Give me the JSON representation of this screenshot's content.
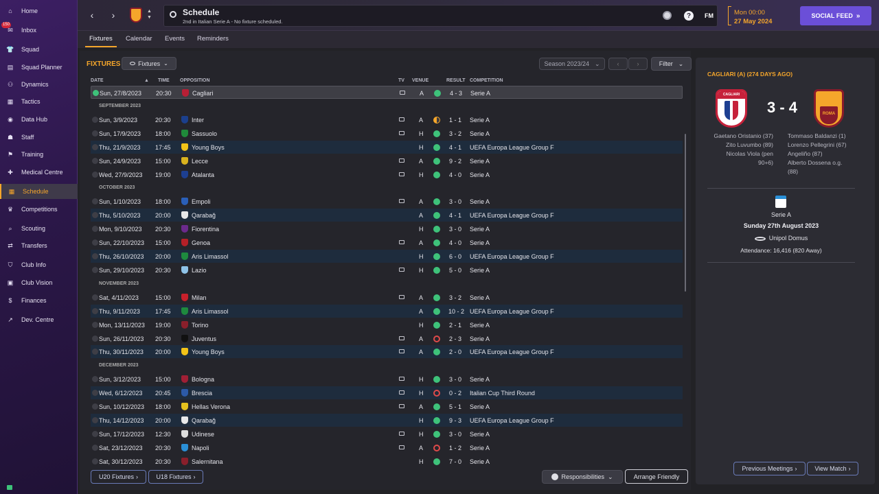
{
  "sidebar": {
    "inbox_badge": "150",
    "items": [
      {
        "label": "Home",
        "icon": "home-icon"
      },
      {
        "label": "Inbox",
        "icon": "inbox-icon"
      },
      {
        "label": "Squad",
        "icon": "squad-icon"
      },
      {
        "label": "Squad Planner",
        "icon": "clipboard-icon"
      },
      {
        "label": "Dynamics",
        "icon": "dynamics-icon"
      },
      {
        "label": "Tactics",
        "icon": "tactics-icon"
      },
      {
        "label": "Data Hub",
        "icon": "data-hub-icon"
      },
      {
        "label": "Staff",
        "icon": "staff-icon"
      },
      {
        "label": "Training",
        "icon": "training-icon"
      },
      {
        "label": "Medical Centre",
        "icon": "medical-icon"
      },
      {
        "label": "Schedule",
        "icon": "calendar-icon"
      },
      {
        "label": "Competitions",
        "icon": "trophy-icon"
      },
      {
        "label": "Scouting",
        "icon": "scouting-icon"
      },
      {
        "label": "Transfers",
        "icon": "transfers-icon"
      },
      {
        "label": "Club Info",
        "icon": "shield-icon"
      },
      {
        "label": "Club Vision",
        "icon": "club-vision-icon"
      },
      {
        "label": "Finances",
        "icon": "finances-icon"
      },
      {
        "label": "Dev. Centre",
        "icon": "dev-centre-icon"
      }
    ]
  },
  "header": {
    "title": "Schedule",
    "subtitle": "2nd in Italian Serie A - No fixture scheduled.",
    "fm_label": "FM",
    "date_time": "Mon 00:00",
    "date": "27 May 2024",
    "social_feed": "SOCIAL FEED"
  },
  "tabs": [
    "Fixtures",
    "Calendar",
    "Events",
    "Reminders"
  ],
  "toolbar": {
    "section_title": "FIXTURES",
    "view_dropdown": "Fixtures",
    "season": "Season 2023/24",
    "filter": "Filter"
  },
  "columns": {
    "date": "DATE",
    "time": "TIME",
    "opposition": "OPPOSITION",
    "tv": "TV",
    "venue": "VENUE",
    "result": "RESULT",
    "competition": "COMPETITION"
  },
  "rows": [
    {
      "kind": "match",
      "date": "Sun, 27/8/2023",
      "time": "20:30",
      "opp": "Cagliari",
      "tv": true,
      "venue": "A",
      "res": "win",
      "score": "4 - 3",
      "comp": "Serie A",
      "hl": false,
      "first": true,
      "crest": "#b81f35"
    },
    {
      "kind": "month",
      "label": "SEPTEMBER 2023"
    },
    {
      "kind": "match",
      "date": "Sun, 3/9/2023",
      "time": "20:30",
      "opp": "Inter",
      "tv": true,
      "venue": "A",
      "res": "draw",
      "score": "1 - 1",
      "comp": "Serie A",
      "hl": false,
      "crest": "#1b3f8c"
    },
    {
      "kind": "match",
      "date": "Sun, 17/9/2023",
      "time": "18:00",
      "opp": "Sassuolo",
      "tv": true,
      "venue": "H",
      "res": "win",
      "score": "3 - 2",
      "comp": "Serie A",
      "hl": false,
      "crest": "#1f8a3a"
    },
    {
      "kind": "match",
      "date": "Thu, 21/9/2023",
      "time": "17:45",
      "opp": "Young Boys",
      "tv": false,
      "venue": "H",
      "res": "win",
      "score": "4 - 1",
      "comp": "UEFA Europa League Group F",
      "hl": true,
      "crest": "#f2c318"
    },
    {
      "kind": "match",
      "date": "Sun, 24/9/2023",
      "time": "15:00",
      "opp": "Lecce",
      "tv": true,
      "venue": "A",
      "res": "win",
      "score": "9 - 2",
      "comp": "Serie A",
      "hl": false,
      "crest": "#d9b21e"
    },
    {
      "kind": "match",
      "date": "Wed, 27/9/2023",
      "time": "19:00",
      "opp": "Atalanta",
      "tv": true,
      "venue": "H",
      "res": "win",
      "score": "4 - 0",
      "comp": "Serie A",
      "hl": false,
      "crest": "#1d3f91"
    },
    {
      "kind": "month",
      "label": "OCTOBER 2023"
    },
    {
      "kind": "match",
      "date": "Sun, 1/10/2023",
      "time": "18:00",
      "opp": "Empoli",
      "tv": true,
      "venue": "A",
      "res": "win",
      "score": "3 - 0",
      "comp": "Serie A",
      "hl": false,
      "crest": "#2a5fb8"
    },
    {
      "kind": "match",
      "date": "Thu, 5/10/2023",
      "time": "20:00",
      "opp": "Qarabağ",
      "tv": false,
      "venue": "A",
      "res": "win",
      "score": "4 - 1",
      "comp": "UEFA Europa League Group F",
      "hl": true,
      "crest": "#e8e8e8"
    },
    {
      "kind": "match",
      "date": "Mon, 9/10/2023",
      "time": "20:30",
      "opp": "Fiorentina",
      "tv": false,
      "venue": "H",
      "res": "win",
      "score": "3 - 0",
      "comp": "Serie A",
      "hl": false,
      "crest": "#6b2a8c"
    },
    {
      "kind": "match",
      "date": "Sun, 22/10/2023",
      "time": "15:00",
      "opp": "Genoa",
      "tv": true,
      "venue": "A",
      "res": "win",
      "score": "4 - 0",
      "comp": "Serie A",
      "hl": false,
      "crest": "#b52027"
    },
    {
      "kind": "match",
      "date": "Thu, 26/10/2023",
      "time": "20:00",
      "opp": "Aris Limassol",
      "tv": false,
      "venue": "H",
      "res": "win",
      "score": "6 - 0",
      "comp": "UEFA Europa League Group F",
      "hl": true,
      "crest": "#1e8a3e"
    },
    {
      "kind": "match",
      "date": "Sun, 29/10/2023",
      "time": "20:30",
      "opp": "Lazio",
      "tv": true,
      "venue": "H",
      "res": "win",
      "score": "5 - 0",
      "comp": "Serie A",
      "hl": false,
      "crest": "#8fc3e8"
    },
    {
      "kind": "month",
      "label": "NOVEMBER 2023"
    },
    {
      "kind": "match",
      "date": "Sat, 4/11/2023",
      "time": "15:00",
      "opp": "Milan",
      "tv": true,
      "venue": "A",
      "res": "win",
      "score": "3 - 2",
      "comp": "Serie A",
      "hl": false,
      "crest": "#c7202b"
    },
    {
      "kind": "match",
      "date": "Thu, 9/11/2023",
      "time": "17:45",
      "opp": "Aris Limassol",
      "tv": false,
      "venue": "A",
      "res": "win",
      "score": "10 - 2",
      "comp": "UEFA Europa League Group F",
      "hl": true,
      "crest": "#1e8a3e"
    },
    {
      "kind": "match",
      "date": "Mon, 13/11/2023",
      "time": "19:00",
      "opp": "Torino",
      "tv": false,
      "venue": "H",
      "res": "win",
      "score": "2 - 1",
      "comp": "Serie A",
      "hl": false,
      "crest": "#8a1f2b"
    },
    {
      "kind": "match",
      "date": "Sun, 26/11/2023",
      "time": "20:30",
      "opp": "Juventus",
      "tv": true,
      "venue": "A",
      "res": "loss",
      "score": "2 - 3",
      "comp": "Serie A",
      "hl": false,
      "crest": "#111111"
    },
    {
      "kind": "match",
      "date": "Thu, 30/11/2023",
      "time": "20:00",
      "opp": "Young Boys",
      "tv": true,
      "venue": "A",
      "res": "win",
      "score": "2 - 0",
      "comp": "UEFA Europa League Group F",
      "hl": true,
      "crest": "#f2c318"
    },
    {
      "kind": "month",
      "label": "DECEMBER 2023"
    },
    {
      "kind": "match",
      "date": "Sun, 3/12/2023",
      "time": "15:00",
      "opp": "Bologna",
      "tv": true,
      "venue": "H",
      "res": "win",
      "score": "3 - 0",
      "comp": "Serie A",
      "hl": false,
      "crest": "#a01f35"
    },
    {
      "kind": "match",
      "date": "Wed, 6/12/2023",
      "time": "20:45",
      "opp": "Brescia",
      "tv": true,
      "venue": "H",
      "res": "loss",
      "score": "0 - 2",
      "comp": "Italian Cup Third Round",
      "hl": true,
      "crest": "#2c5aa8"
    },
    {
      "kind": "match",
      "date": "Sun, 10/12/2023",
      "time": "18:00",
      "opp": "Hellas Verona",
      "tv": true,
      "venue": "A",
      "res": "win",
      "score": "5 - 1",
      "comp": "Serie A",
      "hl": false,
      "crest": "#e6c21e"
    },
    {
      "kind": "match",
      "date": "Thu, 14/12/2023",
      "time": "20:00",
      "opp": "Qarabağ",
      "tv": false,
      "venue": "H",
      "res": "win",
      "score": "9 - 3",
      "comp": "UEFA Europa League Group F",
      "hl": true,
      "crest": "#e8e8e8"
    },
    {
      "kind": "match",
      "date": "Sun, 17/12/2023",
      "time": "12:30",
      "opp": "Udinese",
      "tv": true,
      "venue": "H",
      "res": "win",
      "score": "3 - 0",
      "comp": "Serie A",
      "hl": false,
      "crest": "#dddddd"
    },
    {
      "kind": "match",
      "date": "Sat, 23/12/2023",
      "time": "20:30",
      "opp": "Napoli",
      "tv": true,
      "venue": "A",
      "res": "loss",
      "score": "1 - 2",
      "comp": "Serie A",
      "hl": false,
      "crest": "#2a8fd6"
    },
    {
      "kind": "match",
      "date": "Sat, 30/12/2023",
      "time": "20:30",
      "opp": "Salernitana",
      "tv": false,
      "venue": "H",
      "res": "win",
      "score": "7 - 0",
      "comp": "Serie A",
      "hl": false,
      "crest": "#8a1f2b"
    }
  ],
  "bottom": {
    "u20": "U20 Fixtures",
    "u18": "U18 Fixtures",
    "responsibilities": "Responsibilities",
    "arrange": "Arrange Friendly"
  },
  "panel": {
    "title": "CAGLIARI (A) (274 DAYS AGO)",
    "home_crest_text": "CAGLIARI",
    "away_crest_text": "ROMA",
    "score": "3 - 4",
    "home_scorers": [
      "Gaetano Oristanio (37)",
      "Zito Luvumbo (89)",
      "Nicolas Viola (pen",
      "90+6)"
    ],
    "away_scorers": [
      "Tommaso Baldanzi (1)",
      "Lorenzo Pellegrini (67)",
      "Angeliño (87)",
      "Alberto Dossena o.g.",
      "(88)"
    ],
    "competition": "Serie A",
    "match_date": "Sunday 27th August 2023",
    "stadium": "Unipol Domus",
    "attendance": "Attendance: 16,416 (820 Away)",
    "prev": "Previous Meetings",
    "view": "View Match"
  },
  "colors": {
    "accent": "#f5a62b",
    "win": "#3ec27a",
    "loss": "#e04a4a",
    "social": "#6b4fd8"
  }
}
